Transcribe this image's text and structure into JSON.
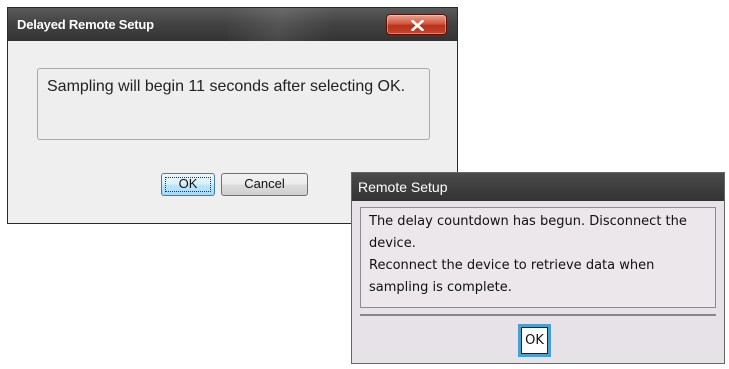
{
  "dialog_delayed": {
    "title": "Delayed Remote Setup",
    "close_icon": "close-x-icon",
    "message": "Sampling will begin 11 seconds after selecting OK.",
    "ok_label": "OK",
    "cancel_label": "Cancel"
  },
  "dialog_remote": {
    "title": "Remote Setup",
    "message_lines": [
      "The delay countdown has begun.  Disconnect the device.",
      "Reconnect the device to retrieve data when sampling is complete."
    ],
    "ok_label": "OK"
  },
  "colors": {
    "titlebar": "#3a3a3a",
    "close_button": "#c9442a",
    "focus_blue": "#4a9fd1"
  }
}
